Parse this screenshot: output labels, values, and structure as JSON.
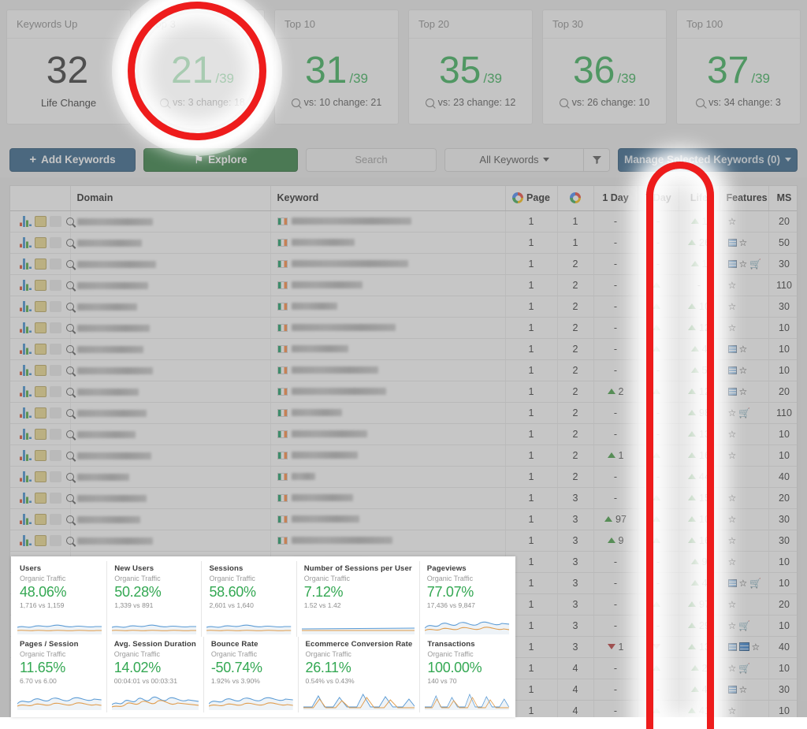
{
  "stats": [
    {
      "title": "Keywords Up",
      "value": "32",
      "denominator": "",
      "sub": "Life Change",
      "has_icon": false,
      "dark": true
    },
    {
      "title": "Top 3",
      "value": "21",
      "denominator": "/39",
      "sub": "vs: 3 change: 18",
      "has_icon": true,
      "dark": false
    },
    {
      "title": "Top 10",
      "value": "31",
      "denominator": "/39",
      "sub": "vs: 10 change: 21",
      "has_icon": true,
      "dark": false
    },
    {
      "title": "Top 20",
      "value": "35",
      "denominator": "/39",
      "sub": "vs: 23 change: 12",
      "has_icon": true,
      "dark": false
    },
    {
      "title": "Top 30",
      "value": "36",
      "denominator": "/39",
      "sub": "vs: 26 change: 10",
      "has_icon": true,
      "dark": false
    },
    {
      "title": "Top 100",
      "value": "37",
      "denominator": "/39",
      "sub": "vs: 34 change: 3",
      "has_icon": true,
      "dark": false
    }
  ],
  "toolbar": {
    "add_keywords_label": "Add Keywords",
    "explore_label": "Explore",
    "search_placeholder": "Search",
    "all_keywords_label": "All Keywords",
    "filter_icon": "funnel-icon",
    "manage_label": "Manage Selected Keywords (0)"
  },
  "table": {
    "headers": {
      "icons": "",
      "domain": "Domain",
      "keyword": "Keyword",
      "page": "Page",
      "google": "",
      "one_day": "1 Day",
      "seven_day": "7 Day",
      "life": "Life",
      "features": "Features",
      "ms": "MS",
      "check": ""
    },
    "rows": [
      {
        "dom_w": 96,
        "kw_w": 152,
        "page": "1",
        "g": "1",
        "d1": "-",
        "d7": "-",
        "d7_dir": "",
        "life": "1",
        "life_dir": "up",
        "feat": [
          "star"
        ],
        "ms": "20"
      },
      {
        "dom_w": 82,
        "kw_w": 80,
        "page": "1",
        "g": "1",
        "d1": "-",
        "d7": "-",
        "d7_dir": "",
        "life": "26",
        "life_dir": "up",
        "feat": [
          "box",
          "star"
        ],
        "ms": "50"
      },
      {
        "dom_w": 100,
        "kw_w": 148,
        "page": "1",
        "g": "2",
        "d1": "-",
        "d7": "-",
        "d7_dir": "",
        "life": "1",
        "life_dir": "up",
        "feat": [
          "box",
          "star",
          "cart"
        ],
        "ms": "30"
      },
      {
        "dom_w": 90,
        "kw_w": 90,
        "page": "1",
        "g": "2",
        "d1": "-",
        "d7": "",
        "d7_dir": "up",
        "life": "-",
        "life_dir": "",
        "feat": [
          "star"
        ],
        "ms": "110"
      },
      {
        "dom_w": 76,
        "kw_w": 58,
        "page": "1",
        "g": "2",
        "d1": "-",
        "d7": "",
        "d7_dir": "up",
        "life": "10",
        "life_dir": "up",
        "feat": [
          "star"
        ],
        "ms": "30"
      },
      {
        "dom_w": 92,
        "kw_w": 132,
        "page": "1",
        "g": "2",
        "d1": "-",
        "d7": "",
        "d7_dir": "up",
        "life": "12",
        "life_dir": "up",
        "feat": [
          "star"
        ],
        "ms": "10"
      },
      {
        "dom_w": 84,
        "kw_w": 72,
        "page": "1",
        "g": "2",
        "d1": "-",
        "d7": "",
        "d7_dir": "up",
        "life": "4",
        "life_dir": "up",
        "feat": [
          "box",
          "star"
        ],
        "ms": "10"
      },
      {
        "dom_w": 96,
        "kw_w": 110,
        "page": "1",
        "g": "2",
        "d1": "-",
        "d7": "-",
        "d7_dir": "",
        "life": "5",
        "life_dir": "up",
        "feat": [
          "box",
          "star"
        ],
        "ms": "10"
      },
      {
        "dom_w": 78,
        "kw_w": 120,
        "page": "1",
        "g": "2",
        "d1": "2",
        "d1_dir": "up",
        "d7": "",
        "d7_dir": "up",
        "life": "12",
        "life_dir": "up",
        "feat": [
          "box",
          "star"
        ],
        "ms": "20"
      },
      {
        "dom_w": 88,
        "kw_w": 64,
        "page": "1",
        "g": "2",
        "d1": "-",
        "d7": "-",
        "d7_dir": "",
        "life": "98",
        "life_dir": "up",
        "feat": [
          "star",
          "cart"
        ],
        "ms": "110"
      },
      {
        "dom_w": 74,
        "kw_w": 96,
        "page": "1",
        "g": "2",
        "d1": "-",
        "d7": "-",
        "d7_dir": "",
        "life": "13",
        "life_dir": "up",
        "feat": [
          "star"
        ],
        "ms": "10"
      },
      {
        "dom_w": 94,
        "kw_w": 84,
        "page": "1",
        "g": "2",
        "d1": "1",
        "d1_dir": "up",
        "d7": "",
        "d7_dir": "up",
        "life": "16",
        "life_dir": "up",
        "feat": [
          "star"
        ],
        "ms": "10"
      },
      {
        "dom_w": 66,
        "kw_w": 30,
        "page": "1",
        "g": "2",
        "d1": "-",
        "d7": "-",
        "d7_dir": "",
        "life": "44",
        "life_dir": "up",
        "feat": [],
        "ms": "40"
      },
      {
        "dom_w": 88,
        "kw_w": 78,
        "page": "1",
        "g": "3",
        "d1": "-",
        "d7": "",
        "d7_dir": "up",
        "life": "15",
        "life_dir": "up",
        "feat": [
          "star"
        ],
        "ms": "20"
      },
      {
        "dom_w": 80,
        "kw_w": 86,
        "page": "1",
        "g": "3",
        "d1": "97",
        "d1_dir": "up",
        "d7": "",
        "d7_dir": "up",
        "life": "10",
        "life_dir": "up",
        "feat": [
          "star"
        ],
        "ms": "30"
      },
      {
        "dom_w": 96,
        "kw_w": 128,
        "page": "1",
        "g": "3",
        "d1": "9",
        "d1_dir": "up",
        "d7": "",
        "d7_dir": "up",
        "life": "16",
        "life_dir": "up",
        "feat": [
          "star"
        ],
        "ms": "30"
      },
      {
        "dom_w": 84,
        "kw_w": 100,
        "page": "1",
        "g": "3",
        "d1": "-",
        "d7": "-",
        "d7_dir": "",
        "life": "9",
        "life_dir": "up",
        "feat": [
          "star"
        ],
        "ms": "10"
      },
      {
        "dom_w": 90,
        "kw_w": 70,
        "page": "1",
        "g": "3",
        "d1": "-",
        "d7": "-",
        "d7_dir": "",
        "life": "4",
        "life_dir": "up",
        "feat": [
          "box",
          "star",
          "cart"
        ],
        "ms": "10"
      },
      {
        "dom_w": 72,
        "kw_w": 110,
        "page": "1",
        "g": "3",
        "d1": "-",
        "d7": "",
        "d7_dir": "up",
        "life": "97",
        "life_dir": "up",
        "feat": [
          "star"
        ],
        "ms": "20"
      },
      {
        "dom_w": 98,
        "kw_w": 92,
        "page": "1",
        "g": "3",
        "d1": "-",
        "d7": "-",
        "d7_dir": "",
        "life": "29",
        "life_dir": "up",
        "feat": [
          "star",
          "cart"
        ],
        "ms": "10"
      },
      {
        "dom_w": 86,
        "kw_w": 64,
        "page": "1",
        "g": "3",
        "d1": "1",
        "d1_dir": "down",
        "d7": "",
        "d7_dir": "down",
        "life": "13",
        "life_dir": "up",
        "feat": [
          "box",
          "box2",
          "star"
        ],
        "ms": "40"
      },
      {
        "dom_w": 76,
        "kw_w": 118,
        "page": "1",
        "g": "4",
        "d1": "-",
        "d7": "",
        "d7_dir": "up",
        "life": "2",
        "life_dir": "up",
        "feat": [
          "star",
          "cart"
        ],
        "ms": "10"
      },
      {
        "dom_w": 92,
        "kw_w": 80,
        "page": "1",
        "g": "4",
        "d1": "-",
        "d7": "-",
        "d7_dir": "",
        "life": "4",
        "life_dir": "up",
        "feat": [
          "box",
          "star"
        ],
        "ms": "30"
      },
      {
        "dom_w": 88,
        "kw_w": 104,
        "page": "1",
        "g": "4",
        "d1": "-",
        "d7": "",
        "d7_dir": "up",
        "life": "41",
        "life_dir": "up",
        "feat": [
          "star"
        ],
        "ms": "10"
      }
    ]
  },
  "analytics": {
    "segment": "Organic Traffic",
    "metrics": [
      {
        "title": "Users",
        "pct": "48.06%",
        "cmp": "1,716 vs 1,159",
        "shape": "flat"
      },
      {
        "title": "New Users",
        "pct": "50.28%",
        "cmp": "1,339 vs 891",
        "shape": "flat"
      },
      {
        "title": "Sessions",
        "pct": "58.60%",
        "cmp": "2,601 vs 1,640",
        "shape": "flat"
      },
      {
        "title": "Number of Sessions per User",
        "pct": "7.12%",
        "cmp": "1.52 vs 1.42",
        "shape": "flatline"
      },
      {
        "title": "Pageviews",
        "pct": "77.07%",
        "cmp": "17,436 vs 9,847",
        "shape": "wave"
      },
      {
        "title": "Pages / Session",
        "pct": "11.65%",
        "cmp": "6.70 vs 6.00",
        "shape": "wave"
      },
      {
        "title": "Avg. Session Duration",
        "pct": "14.02%",
        "cmp": "00:04:01 vs 00:03:31",
        "shape": "jag"
      },
      {
        "title": "Bounce Rate",
        "pct": "-50.74%",
        "cmp": "1.92% vs 3.90%",
        "shape": "wave"
      },
      {
        "title": "Ecommerce Conversion Rate",
        "pct": "26.11%",
        "cmp": "0.54% vs 0.43%",
        "shape": "spike"
      },
      {
        "title": "Transactions",
        "pct": "100.00%",
        "cmp": "140 vs 70",
        "shape": "spike"
      }
    ]
  },
  "annotations": {
    "circle_highlight_target": "Top 3 stat card",
    "column_highlight_target": "Life column",
    "color": "#ee1c1c"
  }
}
